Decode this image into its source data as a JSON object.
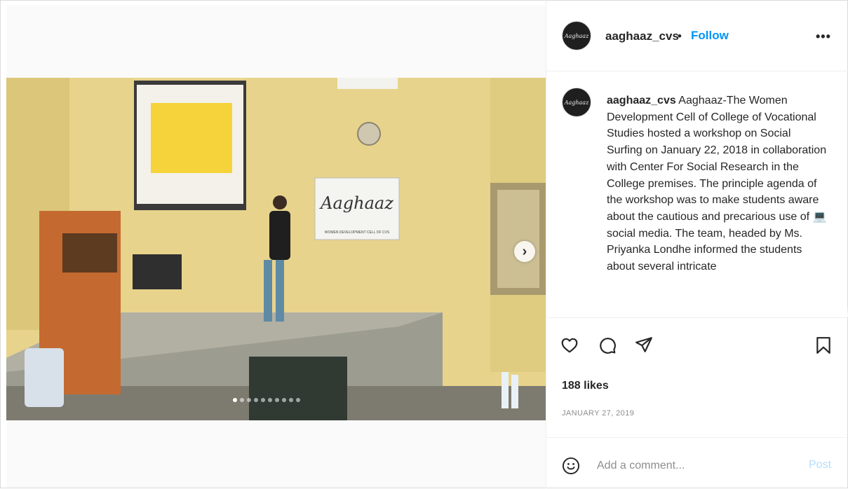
{
  "post": {
    "username": "aaghaaz_cvs",
    "separator": "•",
    "follow_label": "Follow",
    "more_label": "•••",
    "avatar_text": "Aaghaaz",
    "caption_username": "aaghaaz_cvs",
    "caption_text": "Aaghaaz-The Women Development Cell of College of Vocational Studies hosted a workshop on Social Surfing on January 22, 2018 in collaboration with Center For Social Research in the College premises. The principle agenda of the workshop was to make students aware about the cautious and precarious use of 💻 social media. The team, headed by Ms. Priyanka Londhe informed the students about several intricate",
    "likes": "188 likes",
    "date": "JANUARY 27, 2019"
  },
  "media": {
    "banner_text": "Aaghaaz",
    "banner_subtext": "WOMEN DEVELOPMENT CELL OF CVS",
    "next_label": "›",
    "slide_count": 10,
    "active_slide": 1
  },
  "comment": {
    "placeholder": "Add a comment...",
    "post_label": "Post"
  },
  "icons": {
    "like": "heart-icon",
    "comment": "comment-icon",
    "share": "paper-plane-icon",
    "save": "bookmark-icon",
    "emoji": "emoji-icon",
    "next": "chevron-right-icon"
  },
  "colors": {
    "follow": "#0095f6",
    "post_disabled": "#b2dffc",
    "secondary_text": "#8e8e8e"
  }
}
